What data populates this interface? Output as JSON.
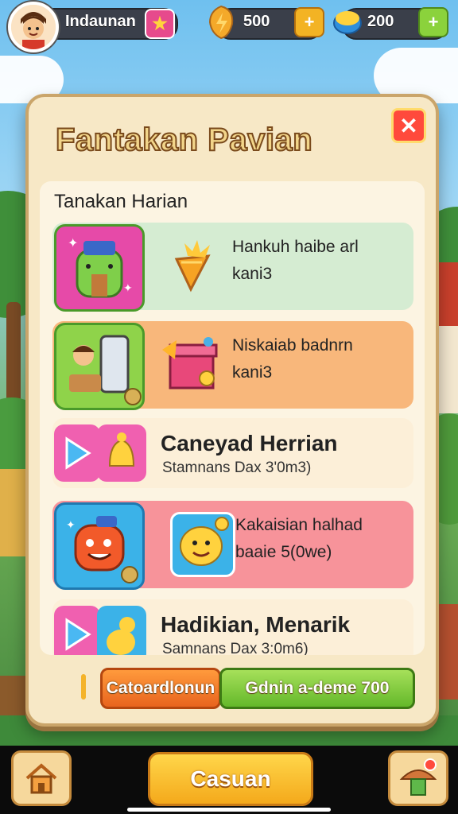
{
  "hud": {
    "player_name": "Indaunan",
    "coins": "500",
    "gems": "200",
    "star_icon": "star-icon",
    "plus_icon": "plus-icon"
  },
  "panel": {
    "title": "Fantakan Pavian",
    "close_glyph": "✕",
    "section_title": "Tanakan Harian",
    "rows": [
      {
        "line1": "Hankuh haibe arl",
        "line2": "kani3",
        "color": "#d5ecd2"
      },
      {
        "line1": "Niskaiab badnrn",
        "line2": "kani3",
        "color": "#f8b77b"
      },
      {
        "line1": "Caneyad Herrian",
        "line2": "Stamnans Dax 3'0m3)",
        "color": "#fcefd8"
      },
      {
        "line1": "Kakaisian halhad",
        "line2": "baaie 5(0we)",
        "color": "#f7939a"
      },
      {
        "line1": "Hadikian, Menarik",
        "line2": "Samnans Dax 3:0m6)",
        "color": "#fcefd8"
      }
    ],
    "orange_button": "Catoardlonun",
    "green_button": "Gdnin a-deme 700"
  },
  "bottom_bar": {
    "main_button": "Casuan"
  }
}
